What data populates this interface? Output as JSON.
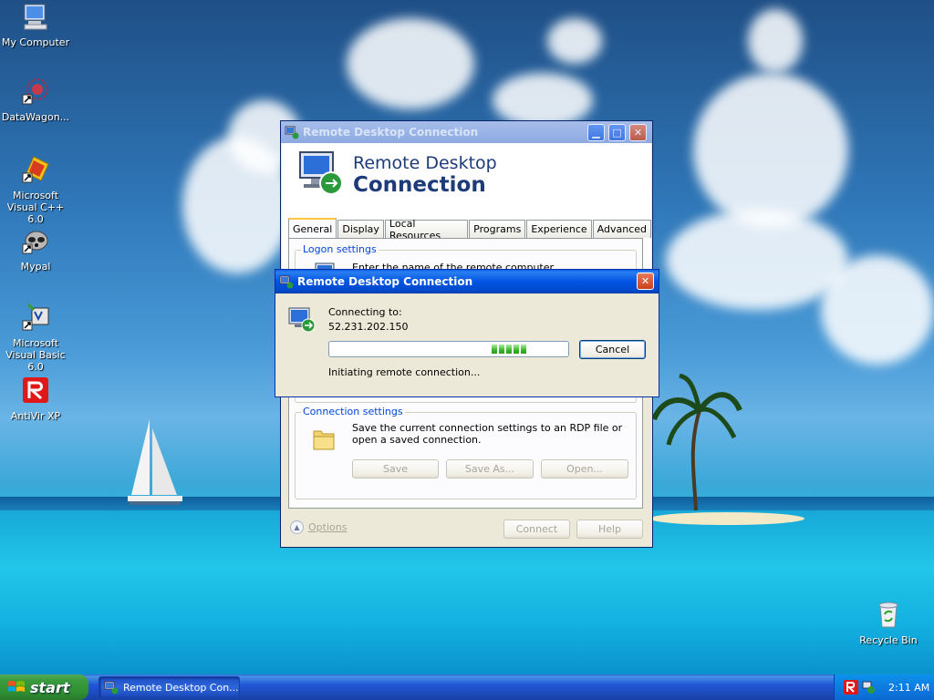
{
  "desktop": {
    "icons": [
      {
        "name": "My Computer"
      },
      {
        "name": "DataWagon..."
      },
      {
        "name": "Microsoft Visual C++ 6.0"
      },
      {
        "name": "Mypal"
      },
      {
        "name": "Microsoft Visual Basic 6.0"
      },
      {
        "name": "AntiVir XP"
      },
      {
        "name": "Recycle Bin"
      }
    ]
  },
  "main_window": {
    "title": "Remote Desktop Connection",
    "banner_line1": "Remote Desktop",
    "banner_line2": "Connection",
    "tabs": [
      "General",
      "Display",
      "Local Resources",
      "Programs",
      "Experience",
      "Advanced"
    ],
    "active_tab": "General",
    "logon_group_title": "Logon settings",
    "logon_text": "Enter the name of the remote computer.",
    "connection_group_title": "Connection settings",
    "connection_text": "Save the current connection settings to an RDP file or open a saved connection.",
    "buttons": {
      "save": "Save",
      "save_as": "Save As...",
      "open": "Open...",
      "connect": "Connect",
      "help": "Help",
      "options": "Options"
    }
  },
  "progress_dialog": {
    "title": "Remote Desktop Connection",
    "connecting_label": "Connecting to:",
    "host": "52.231.202.150",
    "status": "Initiating remote connection...",
    "cancel_label": "Cancel"
  },
  "taskbar": {
    "start_label": "start",
    "task_label": "Remote Desktop Con...",
    "clock": "2:11 AM"
  },
  "colors": {
    "title_blue": "#0054e3",
    "start_green": "#3c9d40",
    "group_title": "#0046d5",
    "progress_green": "#3cb52a"
  }
}
